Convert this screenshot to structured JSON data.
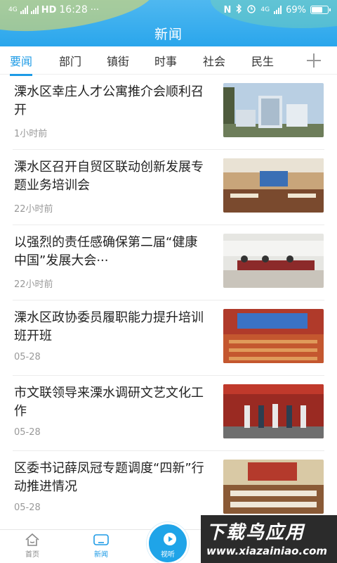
{
  "status_bar": {
    "network_left": "4G",
    "hd": "HD",
    "time": "16:28",
    "dots": "···",
    "nfc": "N",
    "network_right": "4G",
    "battery": "69%",
    "battery_level": 0.69
  },
  "header": {
    "title": "新闻"
  },
  "tabs": [
    {
      "label": "要闻",
      "active": true
    },
    {
      "label": "部门"
    },
    {
      "label": "镇街"
    },
    {
      "label": "时事"
    },
    {
      "label": "社会"
    },
    {
      "label": "民生"
    }
  ],
  "news": [
    {
      "title": "溧水区幸庄人才公寓推介会顺利召开",
      "time": "1小时前"
    },
    {
      "title": "溧水区召开自贸区联动创新发展专题业务培训会",
      "time": "22小时前"
    },
    {
      "title": "以强烈的责任感确保第二届“健康中国”发展大会···",
      "time": "22小时前"
    },
    {
      "title": "溧水区政协委员履职能力提升培训班开班",
      "time": "05-28"
    },
    {
      "title": "市文联领导来溧水调研文艺文化工作",
      "time": "05-28"
    },
    {
      "title": "区委书记薛凤冠专题调度“四新”行动推进情况",
      "time": "05-28"
    }
  ],
  "bottom_nav": {
    "home": "首页",
    "news": "新闻",
    "video": "视听"
  },
  "watermark": {
    "big": "下载鸟应用",
    "small": "www.xiazainiao.com"
  },
  "colors": {
    "accent": "#1e9be6",
    "header": "#2aa6ec"
  }
}
